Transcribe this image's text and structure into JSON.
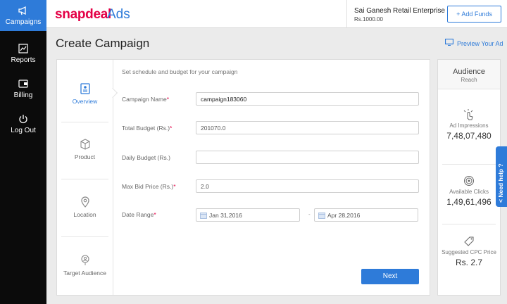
{
  "sidebar": {
    "items": [
      {
        "label": "Campaigns",
        "icon": "megaphone-icon",
        "active": true
      },
      {
        "label": "Reports",
        "icon": "reports-icon"
      },
      {
        "label": "Billing",
        "icon": "wallet-icon"
      },
      {
        "label": "Log Out",
        "icon": "power-icon"
      }
    ]
  },
  "header": {
    "logo_text": "snapdeal",
    "logo_suffix": "Ads",
    "account_name": "Sai Ganesh Retail Enterprise",
    "account_balance": "Rs.1000.00",
    "add_funds_label": "Add Funds"
  },
  "page": {
    "title": "Create Campaign",
    "preview_label": "Preview Your Ad"
  },
  "steps": [
    {
      "label": "Overview",
      "icon": "overview-icon",
      "active": true
    },
    {
      "label": "Product",
      "icon": "box-icon"
    },
    {
      "label": "Location",
      "icon": "location-pin-icon"
    },
    {
      "label": "Target Audience",
      "icon": "target-audience-icon"
    }
  ],
  "form": {
    "hint": "Set schedule and budget for your campaign",
    "fields": [
      {
        "label": "Campaign Name",
        "required": true,
        "value": "campaign183060"
      },
      {
        "label": "Total Budget (Rs.)",
        "required": true,
        "value": "201070.0"
      },
      {
        "label": "Daily Budget (Rs.)",
        "required": false,
        "value": ""
      },
      {
        "label": "Max Bid Price (Rs.)",
        "required": true,
        "value": "2.0"
      }
    ],
    "date_range": {
      "label": "Date Range",
      "required": true,
      "start": "Jan 31,2016",
      "end": "Apr 28,2016",
      "separator": "-"
    },
    "required_mark": "*",
    "next_label": "Next"
  },
  "audience": {
    "title": "Audience",
    "subtitle": "Reach",
    "metrics": [
      {
        "label": "Ad Impressions",
        "value": "7,48,07,480",
        "icon": "tap-icon"
      },
      {
        "label": "Available Clicks",
        "value": "1,49,61,496",
        "icon": "target-icon"
      },
      {
        "label": "Suggested CPC Price",
        "value": "Rs. 2.7",
        "icon": "price-tag-icon"
      }
    ]
  },
  "help": {
    "label": "Need help ?",
    "arrow": "<"
  },
  "colors": {
    "brand_blue": "#2e7bd9",
    "brand_red": "#e40046",
    "sidebar_bg": "#0b0b0b"
  }
}
